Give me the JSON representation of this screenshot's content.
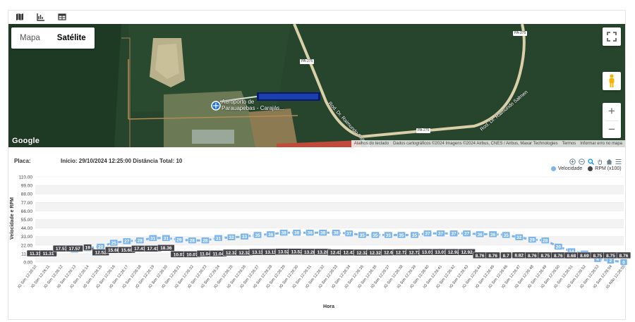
{
  "tabs": [
    {
      "icon": "map-icon"
    },
    {
      "icon": "chart-icon"
    },
    {
      "icon": "table-icon"
    }
  ],
  "map": {
    "type_buttons": [
      "Mapa",
      "Satélite"
    ],
    "active_type": "Satélite",
    "place_label_1": "Aeroporto de",
    "place_label_2": "Parauapebas - Carajás...",
    "road_labels": [
      "Rod. Dr. Raimundo Salmen",
      "Rod. Dr. Raimundo Salmen"
    ],
    "road_signs": [
      "PA-275",
      "PA-275",
      "PA-275"
    ],
    "logo": "Google",
    "attribution": [
      "Atalhos do teclado",
      "Dados cartográficos ©2024 Imagens ©2024 Airbus, CNES / Airbus, Maxar Technologies",
      "Termos",
      "Informar erro no mapa"
    ]
  },
  "info": {
    "placa_label": "Placa:",
    "summary": "Início: 29/10/2024 12:25:00 Distância Total: 10"
  },
  "chart_data": {
    "type": "line",
    "ylabel": "Velocidade e RPM",
    "xlabel": "Hora",
    "ylim": [
      0,
      110
    ],
    "yticks": [
      "0.00",
      "11.00",
      "22.00",
      "33.00",
      "44.00",
      "55.00",
      "66.00",
      "77.00",
      "88.00",
      "99.00",
      "110.00"
    ],
    "legend_position": "top-right",
    "categories": [
      "IG Sim 12:26:10",
      "IG Sim 12:26:11",
      "IG Sim 12:26:12",
      "IG Sim 12:26:13",
      "IG Sim 12:26:14",
      "IG Sim 12:26:15",
      "IG Sim 12:26:16",
      "IG Sim 12:26:17",
      "IG Sim 12:26:18",
      "IG Sim 12:26:19",
      "IG Sim 12:26:20",
      "IG Sim 12:26:21",
      "IG Sim 12:26:22",
      "IG Sim 12:26:23",
      "IG Sim 12:26:24",
      "IG Sim 12:26:25",
      "IG Sim 12:26:26",
      "IG Sim 12:26:27",
      "IG Sim 12:26:28",
      "IG Sim 12:26:29",
      "IG Sim 12:26:30",
      "IG Sim 12:26:31",
      "IG Sim 12:26:32",
      "IG Sim 12:26:33",
      "IG Sim 12:26:34",
      "IG Sim 12:26:35",
      "IG Sim 12:26:36",
      "IG Sim 12:26:37",
      "IG Sim 12:26:38",
      "IG Sim 12:26:39",
      "IG Sim 12:26:40",
      "IG Sim 12:26:41",
      "IG Sim 12:26:42",
      "IG Sim 12:26:43",
      "IG Sim 12:26:44",
      "IG Sim 12:26:45",
      "IG Sim 12:26:46",
      "IG Sim 12:26:47",
      "IG Sim 12:26:48",
      "IG Sim 12:26:49",
      "IG Sim 12:26:50",
      "IG Sim 12:26:51",
      "IG Sim 12:26:52",
      "IG Sim 12:26:53",
      "IG Sim 12:26:54",
      "IG Não 12:26:55"
    ],
    "series": [
      {
        "name": "Velocidade",
        "color": "#7cb5ec",
        "values": [
          11,
          11,
          18,
          16,
          18,
          20,
          25,
          27,
          28,
          31,
          31,
          29,
          28,
          28,
          31,
          32,
          33,
          35,
          36,
          38,
          38,
          38,
          38,
          38,
          37,
          35,
          35,
          35,
          35,
          35,
          37,
          37,
          37,
          37,
          36,
          36,
          35,
          32,
          29,
          28,
          20,
          14,
          11,
          4,
          2,
          0
        ]
      },
      {
        "name": "RPM (x100)",
        "color": "#434348",
        "values": [
          11.31,
          11.31,
          17.57,
          17.57,
          19,
          12.52,
          15.68,
          15.68,
          17.41,
          17.41,
          18.36,
          10.07,
          10.07,
          11.04,
          11.04,
          12.32,
          12.32,
          13.11,
          13.11,
          13.52,
          13.52,
          13.28,
          13.28,
          12.43,
          12.43,
          12.32,
          12.32,
          12.6,
          12.72,
          12.72,
          13.01,
          13.01,
          12.92,
          12.92,
          8.76,
          8.76,
          8.7,
          8.82,
          8.76,
          8.75,
          8.76,
          8.68,
          8.69,
          8.75,
          8.75,
          8.76
        ]
      }
    ]
  }
}
